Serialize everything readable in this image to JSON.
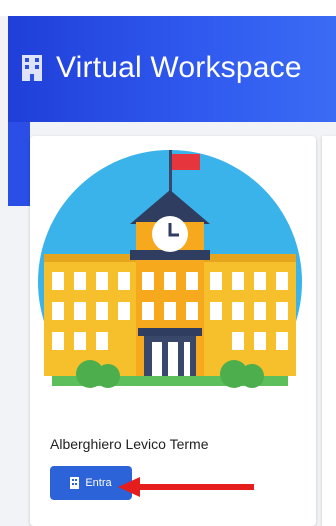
{
  "header": {
    "title": "Virtual Workspace",
    "icon": "building-icon",
    "color": "#2a4ee6"
  },
  "card": {
    "illustration": "school-building-illustration",
    "title": "Alberghiero Levico Terme",
    "button_label": "Entra",
    "button_icon": "building-icon",
    "button_color": "#2d63d8"
  },
  "annotation": {
    "arrow_color": "#e61d1d",
    "arrow_icon": "arrow-left-icon"
  }
}
